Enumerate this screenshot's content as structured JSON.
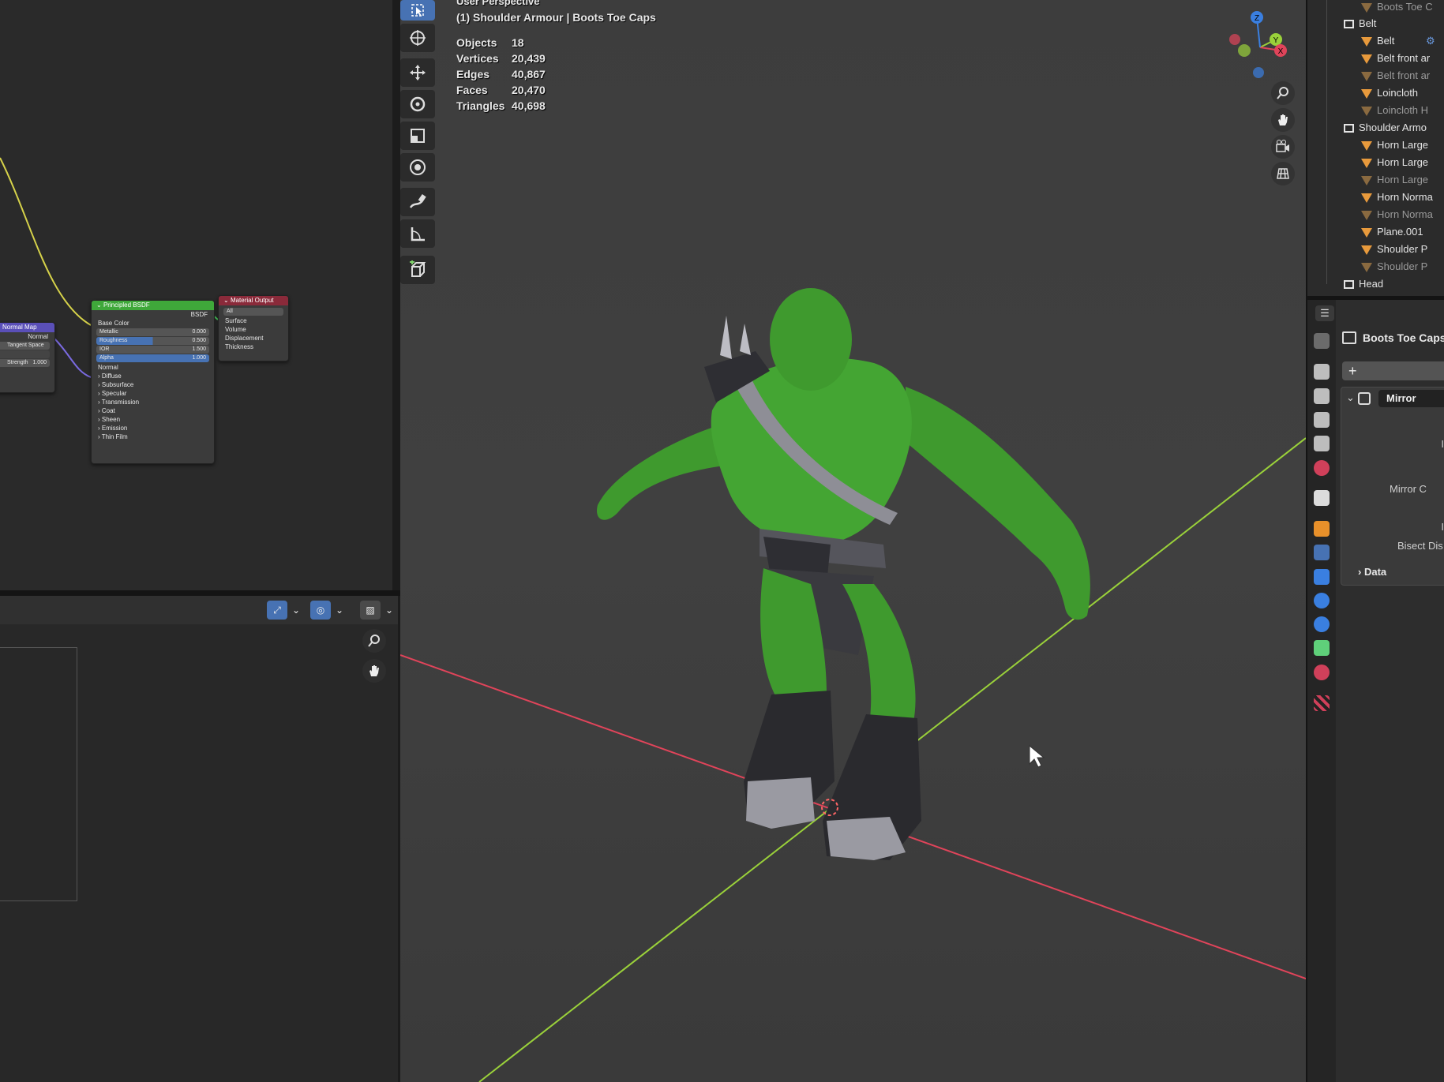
{
  "viewport": {
    "perspective_label": "User Perspective",
    "object_label": "(1) Shoulder Armour | Boots Toe Caps",
    "stats": [
      {
        "label": "Objects",
        "value": "18"
      },
      {
        "label": "Vertices",
        "value": "20,439"
      },
      {
        "label": "Edges",
        "value": "40,867"
      },
      {
        "label": "Faces",
        "value": "20,470"
      },
      {
        "label": "Triangles",
        "value": "40,698"
      }
    ],
    "gizmo_axes": {
      "x": "X",
      "y": "Y",
      "z": "Z"
    },
    "tools": [
      "select-box-icon",
      "cursor-icon",
      "move-icon",
      "rotate-icon",
      "scale-icon",
      "transform-icon",
      "annotate-icon",
      "measure-icon",
      "add-cube-icon"
    ],
    "nav_buttons": [
      "zoom-icon",
      "pan-hand-icon",
      "camera-icon",
      "grid-toggle-icon"
    ]
  },
  "node_editor": {
    "normal_map": {
      "title": "Normal Map",
      "output": "Normal",
      "space": "Tangent Space",
      "strength_label": "Strength",
      "strength_value": "1.000"
    },
    "principled": {
      "title": "Principled BSDF",
      "output": "BSDF",
      "base_color": "Base Color",
      "fields": [
        {
          "label": "Metallic",
          "value": "0.000",
          "highlight": false
        },
        {
          "label": "Roughness",
          "value": "0.500",
          "highlight": true
        },
        {
          "label": "IOR",
          "value": "1.500",
          "highlight": false
        },
        {
          "label": "Alpha",
          "value": "1.000",
          "highlight": true
        }
      ],
      "normal": "Normal",
      "panels": [
        "Diffuse",
        "Subsurface",
        "Specular",
        "Transmission",
        "Coat",
        "Sheen",
        "Emission",
        "Thin Film"
      ]
    },
    "output": {
      "title": "Material Output",
      "target": "All",
      "inputs": [
        "Surface",
        "Volume",
        "Displacement",
        "Thickness"
      ]
    }
  },
  "outliner": {
    "rows": [
      {
        "label": "Boots Toe C",
        "kind": "mesh",
        "dim": true,
        "indent": 1
      },
      {
        "label": "Belt",
        "kind": "collection",
        "dim": false,
        "indent": 0
      },
      {
        "label": "Belt",
        "kind": "mesh",
        "dim": false,
        "indent": 1
      },
      {
        "label": "Belt front ar",
        "kind": "mesh",
        "dim": false,
        "indent": 1
      },
      {
        "label": "Belt front ar",
        "kind": "mesh",
        "dim": true,
        "indent": 1
      },
      {
        "label": "Loincloth",
        "kind": "mesh",
        "dim": false,
        "indent": 1
      },
      {
        "label": "Loincloth H",
        "kind": "mesh",
        "dim": true,
        "indent": 1
      },
      {
        "label": "Shoulder Armo",
        "kind": "collection",
        "dim": false,
        "indent": 0
      },
      {
        "label": "Horn Large",
        "kind": "mesh",
        "dim": false,
        "indent": 1
      },
      {
        "label": "Horn Large",
        "kind": "mesh",
        "dim": false,
        "indent": 1
      },
      {
        "label": "Horn Large",
        "kind": "mesh",
        "dim": true,
        "indent": 1
      },
      {
        "label": "Horn Norma",
        "kind": "mesh",
        "dim": false,
        "indent": 1
      },
      {
        "label": "Horn Norma",
        "kind": "mesh",
        "dim": true,
        "indent": 1
      },
      {
        "label": "Plane.001",
        "kind": "mesh",
        "dim": false,
        "indent": 1
      },
      {
        "label": "Shoulder P",
        "kind": "mesh",
        "dim": false,
        "indent": 1
      },
      {
        "label": "Shoulder P",
        "kind": "mesh",
        "dim": true,
        "indent": 1
      },
      {
        "label": "Head",
        "kind": "collection",
        "dim": false,
        "indent": 0
      }
    ]
  },
  "properties": {
    "object_name": "Boots Toe Caps",
    "add_modifier": "+",
    "modifier_name": "Mirror",
    "partial_labels": [
      "I",
      "Mirror C",
      "I",
      "Bisect Dis"
    ],
    "data_panel": "Data",
    "tabs": [
      "tool-icon",
      "render-icon",
      "output-icon",
      "view-layer-icon",
      "scene-icon",
      "world-icon",
      "collection-icon",
      "object-icon",
      "modifier-icon",
      "particles-icon",
      "physics-icon",
      "constraints-icon",
      "data-icon",
      "material-icon",
      "texture-icon"
    ]
  },
  "colors": {
    "accent": "#4772b3",
    "x_axis": "#e0445a",
    "y_axis": "#9ad13a",
    "z_axis": "#3a7fe0",
    "mesh_icon": "#e89a3c",
    "skin": "#3f9a2e"
  }
}
